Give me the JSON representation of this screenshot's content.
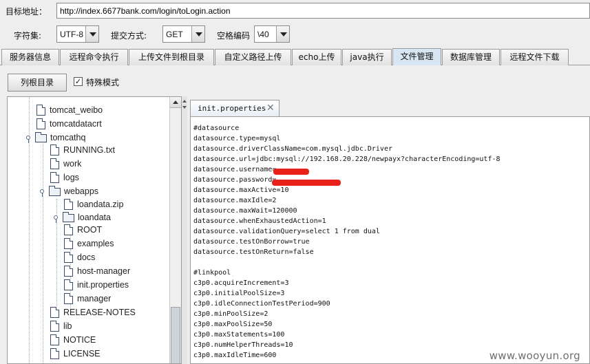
{
  "target": {
    "label": "目标地址：",
    "url": "http://index.6677bank.com/login/toLogin.action"
  },
  "options": {
    "charset_label": "字符集:",
    "charset_value": "UTF-8",
    "method_label": "提交方式:",
    "method_value": "GET",
    "space_label": "空格编码",
    "space_value": "\\40"
  },
  "tabs": [
    "服务器信息",
    "远程命令执行",
    "上传文件到根目录",
    "自定义路径上传",
    "echo上传",
    "java执行",
    "文件管理",
    "数据库管理",
    "远程文件下载"
  ],
  "active_tab": "文件管理",
  "toolbar": {
    "list_root": "列根目录",
    "special_mode": "特殊模式",
    "check_mark": "✓"
  },
  "tree": {
    "items": [
      {
        "label": "tomcat_weibo",
        "kind": "file"
      },
      {
        "label": "tomcatdatacrt",
        "kind": "file"
      },
      {
        "label": "tomcathq",
        "kind": "folder"
      },
      {
        "label": "RUNNING.txt",
        "kind": "file"
      },
      {
        "label": "work",
        "kind": "file"
      },
      {
        "label": "logs",
        "kind": "file"
      },
      {
        "label": "webapps",
        "kind": "folder"
      },
      {
        "label": "loandata.zip",
        "kind": "file"
      },
      {
        "label": "loandata",
        "kind": "folder"
      },
      {
        "label": "ROOT",
        "kind": "file"
      },
      {
        "label": "examples",
        "kind": "file"
      },
      {
        "label": "docs",
        "kind": "file"
      },
      {
        "label": "host-manager",
        "kind": "file"
      },
      {
        "label": "init.properties",
        "kind": "file"
      },
      {
        "label": "manager",
        "kind": "file"
      },
      {
        "label": "RELEASE-NOTES",
        "kind": "file"
      },
      {
        "label": "lib",
        "kind": "file"
      },
      {
        "label": "NOTICE",
        "kind": "file"
      },
      {
        "label": "LICENSE",
        "kind": "file"
      }
    ]
  },
  "editor": {
    "tab_name": "init.properties",
    "close_glyph": "✕",
    "content": "#datasource\ndatasource.type=mysql\ndatasource.driverClassName=com.mysql.jdbc.Driver\ndatasource.url=jdbc:mysql://192.168.20.228/newpayx?characterEncoding=utf-8\ndatasource.username=\ndatasource.password=\ndatasource.maxActive=10\ndatasource.maxIdle=2\ndatasource.maxWait=120000\ndatasource.whenExhaustedAction=1\ndatasource.validationQuery=select 1 from dual\ndatasource.testOnBorrow=true\ndatasource.testOnReturn=false\n\n#linkpool\nc3p0.acquireIncrement=3\nc3p0.initialPoolSize=3\nc3p0.idleConnectionTestPeriod=900\nc3p0.minPoolSize=2\nc3p0.maxPoolSize=50\nc3p0.maxStatements=100\nc3p0.numHelperThreads=10\nc3p0.maxIdleTime=600"
  },
  "watermark": "www.wooyun.org",
  "colors": {
    "active_tab": "#d8e6f4",
    "redaction": "#e8211a"
  }
}
